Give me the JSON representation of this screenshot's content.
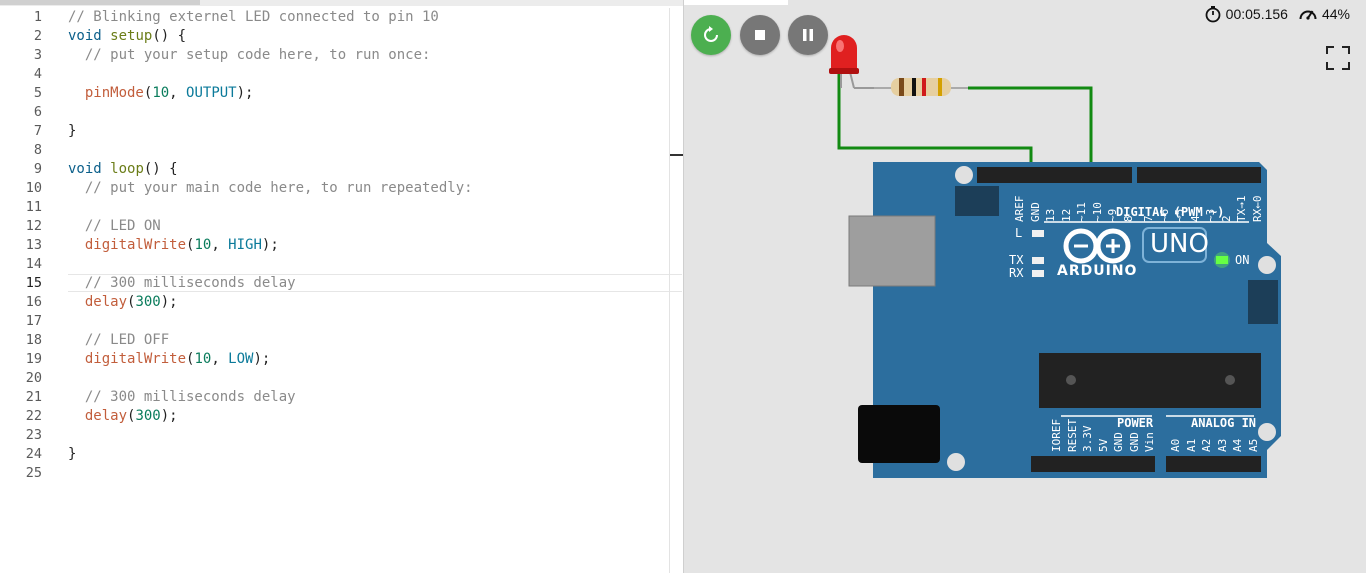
{
  "editor": {
    "active_line": 15,
    "lines": [
      [
        [
          "// Blinking externel LED connected to pin 10",
          "comment"
        ]
      ],
      [
        [
          "void",
          "kw"
        ],
        [
          " ",
          ""
        ],
        [
          "setup",
          "fnname"
        ],
        [
          "() {",
          "punct"
        ]
      ],
      [
        [
          "  // put your setup code here, to run once:",
          "comment"
        ]
      ],
      [],
      [
        [
          "  ",
          ""
        ],
        [
          "pinMode",
          "fn"
        ],
        [
          "(",
          "punct"
        ],
        [
          "10",
          "num"
        ],
        [
          ", ",
          "punct"
        ],
        [
          "OUTPUT",
          "const"
        ],
        [
          ");",
          "punct"
        ]
      ],
      [],
      [
        [
          "}",
          "punct"
        ]
      ],
      [],
      [
        [
          "void",
          "kw"
        ],
        [
          " ",
          ""
        ],
        [
          "loop",
          "fnname"
        ],
        [
          "() {",
          "punct"
        ]
      ],
      [
        [
          "  // put your main code here, to run repeatedly:",
          "comment"
        ]
      ],
      [],
      [
        [
          "  // LED ON",
          "comment"
        ]
      ],
      [
        [
          "  ",
          ""
        ],
        [
          "digitalWrite",
          "fn"
        ],
        [
          "(",
          "punct"
        ],
        [
          "10",
          "num"
        ],
        [
          ", ",
          "punct"
        ],
        [
          "HIGH",
          "const"
        ],
        [
          ");",
          "punct"
        ]
      ],
      [],
      [
        [
          "  // 300 milliseconds delay",
          "comment"
        ]
      ],
      [
        [
          "  ",
          ""
        ],
        [
          "delay",
          "fn"
        ],
        [
          "(",
          "punct"
        ],
        [
          "300",
          "num"
        ],
        [
          ");",
          "punct"
        ]
      ],
      [],
      [
        [
          "  // LED OFF",
          "comment"
        ]
      ],
      [
        [
          "  ",
          ""
        ],
        [
          "digitalWrite",
          "fn"
        ],
        [
          "(",
          "punct"
        ],
        [
          "10",
          "num"
        ],
        [
          ", ",
          "punct"
        ],
        [
          "LOW",
          "const"
        ],
        [
          ");",
          "punct"
        ]
      ],
      [],
      [
        [
          "  // 300 milliseconds delay",
          "comment"
        ]
      ],
      [
        [
          "  ",
          ""
        ],
        [
          "delay",
          "fn"
        ],
        [
          "(",
          "punct"
        ],
        [
          "300",
          "num"
        ],
        [
          ");",
          "punct"
        ]
      ],
      [],
      [
        [
          "}",
          "punct"
        ]
      ],
      []
    ]
  },
  "simulator": {
    "timer": "00:05.156",
    "speed": "44%",
    "controls": {
      "restart_icon": "restart-icon",
      "stop_icon": "stop-icon",
      "pause_icon": "pause-icon"
    },
    "fullscreen_icon": "fullscreen-icon",
    "board": {
      "brand": "ARDUINO",
      "model": "UNO",
      "on_label": "ON",
      "l_label": "L",
      "tx_label": "TX",
      "rx_label": "RX",
      "digital_label": "DIGITAL (PWM ~)",
      "power_label": "POWER",
      "analog_label": "ANALOG IN",
      "top_pins_left": [
        "AREF",
        "GND",
        "13",
        "12",
        "~11",
        "~10",
        "~9",
        "8"
      ],
      "top_pins_right": [
        "7",
        "~6",
        "~5",
        "4",
        "~3",
        "2",
        "TX→1",
        "RX←0"
      ],
      "bottom_pins_power": [
        "IOREF",
        "RESET",
        "3.3V",
        "5V",
        "GND",
        "GND",
        "Vin"
      ],
      "bottom_pins_analog": [
        "A0",
        "A1",
        "A2",
        "A3",
        "A4",
        "A5"
      ]
    },
    "colors": {
      "board": "#2c6e9e",
      "wire": "#128a12",
      "led": "#e02020",
      "restart": "#4caf50",
      "control_gray": "#777777",
      "power_led": "#66ff44"
    }
  }
}
